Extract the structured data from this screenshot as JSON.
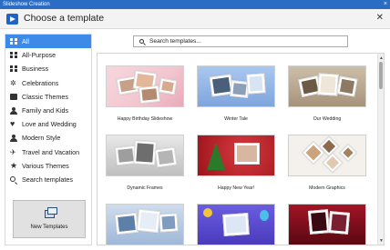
{
  "window": {
    "title": "Slideshow Creation",
    "close_glyph": "×"
  },
  "header": {
    "title": "Choose a template",
    "close_glyph": "✕"
  },
  "sidebar": {
    "items": [
      {
        "label": "All",
        "icon": "grid-icon",
        "active": true
      },
      {
        "label": "All-Purpose",
        "icon": "puzzle-icon"
      },
      {
        "label": "Business",
        "icon": "briefcase-icon"
      },
      {
        "label": "Celebrations",
        "icon": "confetti-icon"
      },
      {
        "label": "Classic Themes",
        "icon": "frame-icon"
      },
      {
        "label": "Family and Kids",
        "icon": "family-icon"
      },
      {
        "label": "Love and Wedding",
        "icon": "heart-icon"
      },
      {
        "label": "Modern Style",
        "icon": "person-icon"
      },
      {
        "label": "Travel and Vacation",
        "icon": "plane-icon"
      },
      {
        "label": "Various Themes",
        "icon": "star-icon"
      },
      {
        "label": "Search templates",
        "icon": "search-icon"
      }
    ],
    "new_templates_label": "New Templates"
  },
  "search": {
    "placeholder": "Search templates..."
  },
  "templates": [
    {
      "label": "Happy Birthday Slideshow",
      "bg": "#f2c6cf",
      "accent": "#e58fa2"
    },
    {
      "label": "Winter Tale",
      "bg": "#8fb4e6",
      "accent": "#5a86c8"
    },
    {
      "label": "Our Wedding",
      "bg": "#c3b49f",
      "accent": "#8a7558"
    },
    {
      "label": "Dynamic Frames",
      "bg": "#d4d4d4",
      "accent": "#9a9a9a"
    },
    {
      "label": "Happy New Year!",
      "bg": "#b32028",
      "accent": "#2d7a2a"
    },
    {
      "label": "Modern Graphics",
      "bg": "#f4f1ec",
      "accent": "#c9a47e"
    },
    {
      "label": "",
      "bg": "#b8cde6",
      "accent": "#5d7fa8"
    },
    {
      "label": "",
      "bg": "#5a4ad0",
      "accent": "#f1c53a"
    },
    {
      "label": "",
      "bg": "#8b0f1e",
      "accent": "#3a0a12"
    }
  ]
}
